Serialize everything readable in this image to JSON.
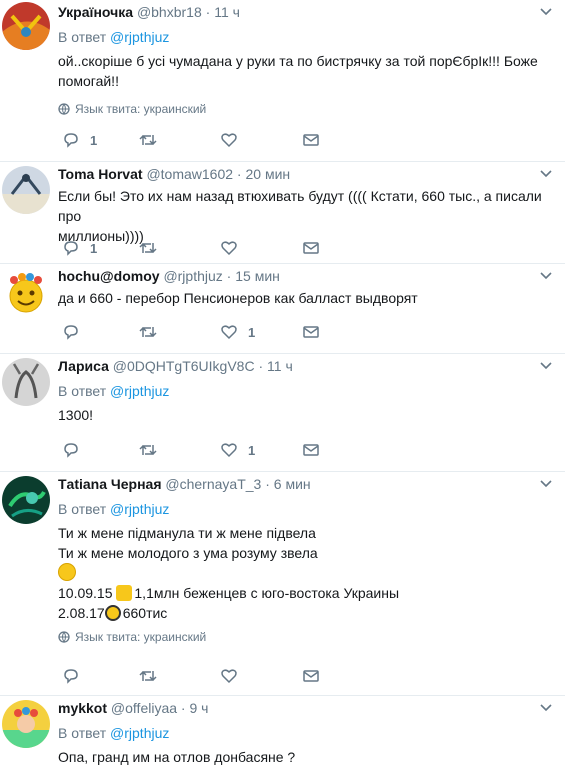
{
  "tweets": [
    {
      "name": "Україночка",
      "handle": "@bhxbr18",
      "time": "11 ч",
      "reply_prefix": "В ответ",
      "reply_to": "@rjpthjuz",
      "lines": [
        "ой..скоріше б усі чумадана у руки та по бистрячку за той порЄбрІк!!! Боже",
        "помогай!!"
      ],
      "lang": "Язык твита: украинский",
      "counts": {
        "reply": "1",
        "retweet": "",
        "like": ""
      }
    },
    {
      "name": "Toma Horvat",
      "handle": "@tomaw1602",
      "time": "20 мин",
      "lines": [
        "Если бы! Это их нам назад втюхивать будут (((( Кстати, 660 тыс.,  а писали про",
        "миллионы))))"
      ],
      "counts": {
        "reply": "1",
        "retweet": "",
        "like": ""
      }
    },
    {
      "name": "hochu@domoy",
      "handle": "@rjpthjuz",
      "time": "15 мин",
      "lines": [
        "да и 660 - перебор Пенсионеров как балласт выдворят"
      ],
      "counts": {
        "reply": "",
        "retweet": "",
        "like": "1"
      }
    },
    {
      "name": "Лариса",
      "handle": "@0DQHTgT6UIkgV8C",
      "time": "11 ч",
      "reply_prefix": "В ответ",
      "reply_to": "@rjpthjuz",
      "lines": [
        "1300!"
      ],
      "counts": {
        "reply": "",
        "retweet": "",
        "like": "1"
      }
    },
    {
      "name": "Тatiana Черная",
      "handle": "@chernayaT_3",
      "time": "6 мин",
      "reply_prefix": "В ответ",
      "reply_to": "@rjpthjuz",
      "lines": [
        "Ти ж мене підманула ти ж мене підвела",
        "Ти ж мене молодого з ума розуму звела"
      ],
      "line3_text": "",
      "line4_pre": "10.09.15",
      "line4_post": "1,1млн беженцев с юго-востока Украины",
      "line5_pre": "2.08.17",
      "line5_post": "660тис",
      "lang": "Язык твита: украинский",
      "counts": {
        "reply": "",
        "retweet": "",
        "like": ""
      }
    },
    {
      "name": "mykkot",
      "handle": "@offeliyaa",
      "time": "9 ч",
      "reply_prefix": "В ответ",
      "reply_to": "@rjpthjuz",
      "lines": [
        "Опа, гранд им на отлов донбасяне ?"
      ]
    }
  ],
  "dot": "·",
  "colors": {
    "link": "#1b95e0",
    "muted": "#657786",
    "border": "#e6ecf0"
  },
  "icons": [
    "reply-icon",
    "retweet-icon",
    "like-icon",
    "direct-message-icon",
    "globe-icon",
    "caret-down-icon"
  ]
}
